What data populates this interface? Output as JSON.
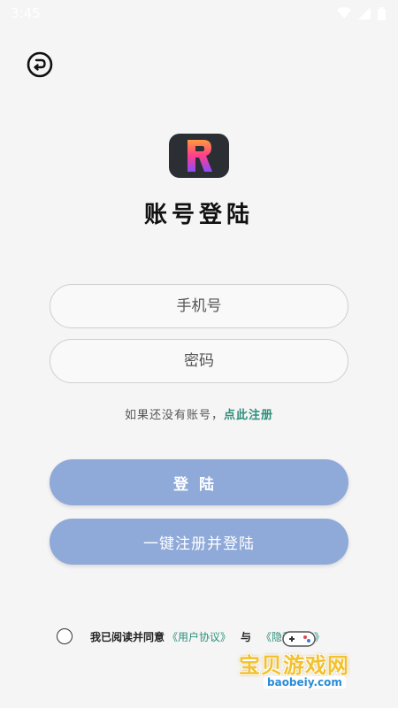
{
  "status_bar": {
    "time": "3:45",
    "icons": [
      "wifi-icon",
      "signal-icon",
      "battery-icon"
    ]
  },
  "header": {
    "back_icon": "back-arrow-icon"
  },
  "app": {
    "logo_letter": "R",
    "title": "账号登陆"
  },
  "form": {
    "phone_placeholder": "手机号",
    "password_placeholder": "密码"
  },
  "register_hint": {
    "text": "如果还没有账号，",
    "link": "点此注册"
  },
  "buttons": {
    "login": "登陆",
    "one_key": "一键注册并登陆"
  },
  "agreement": {
    "prefix": "我已阅读并同意",
    "user_agreement": "《用户协议》",
    "and": "与",
    "privacy_policy": "《隐私政策》"
  },
  "watermark": {
    "title": "宝贝游戏网",
    "url": "baobeiy.com"
  },
  "colors": {
    "background": "#f5f5f5",
    "button": "#8fa9d9",
    "link": "#2e8f7c",
    "logo_bg": "#2b2e33"
  }
}
